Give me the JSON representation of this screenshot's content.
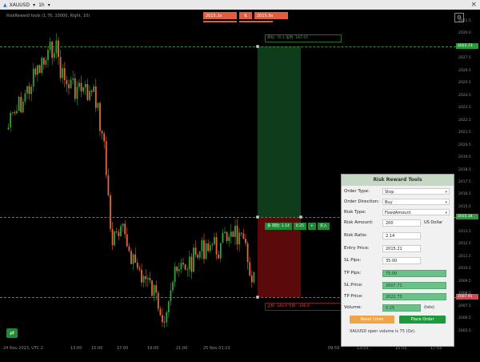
{
  "titlebar": {
    "symbol": "XAUUSD",
    "timeframe": "1h",
    "close_glyph": "×"
  },
  "chart": {
    "indicator_text": "RiskReward tools (1.76, 10000, Right, 10)",
    "bid": "2015.2s",
    "ask": "2015.5s",
    "tp_label": "目标: 70.1 盈利: 187.05",
    "entry_label_parts": [
      "多 风险: 2.14",
      "0.25",
      "+",
      "买入"
    ],
    "sl_label": "止损: 140.9 亏损: -100.0",
    "price_ticks": [
      "2021.5",
      "2020.0",
      "2029.5",
      "2027.5",
      "2026.5",
      "2025.5",
      "2024.5",
      "2023.5",
      "2022.5",
      "2021.5",
      "2020.5",
      "2019.5",
      "2018.5",
      "2017.5",
      "2016.5",
      "2015.5",
      "2014.5",
      "2013.5",
      "2012.5",
      "2011.5",
      "2010.5",
      "2009.5",
      "2008.5",
      "2007.5",
      "2006.5",
      "2005.5"
    ],
    "price_tag_tp": "2022.73",
    "price_tag_entry": "2015.34",
    "price_tag_sl": "2007.91",
    "time_ticks": [
      "24 Nov 2023, UTC 2",
      "13:00",
      "15:00",
      "17:00",
      "19:00",
      "21:00",
      "25 Nov 01:13",
      "09:55",
      "13:55",
      "15:55",
      "17:55"
    ]
  },
  "panel": {
    "title": "Risk Reward Tools",
    "order_type_label": "Order Type:",
    "order_type_value": "Stop",
    "order_direction_label": "Order Direction:",
    "order_direction_value": "Buy",
    "risk_type_label": "Risk Type:",
    "risk_type_value": "FixedAmount",
    "risk_amount_label": "Risk Amount:",
    "risk_amount_value": "200",
    "risk_amount_unit": "US Dollar",
    "risk_ratio_label": "Risk Ratio:",
    "risk_ratio_value": "2.14",
    "entry_price_label": "Entry Price:",
    "entry_price_value": "2015.21",
    "sl_pips_label": "SL Pips:",
    "sl_pips_value": "35.00",
    "tp_pips_label": "TP Pips:",
    "tp_pips_value": "75.00",
    "sl_price_label": "SL Price:",
    "sl_price_value": "2007.71",
    "tp_price_label": "TP Price:",
    "tp_price_value": "2022.73",
    "volume_label": "Volume:",
    "volume_value": "0.25",
    "volume_unit": "(lots)",
    "reset_label": "Reset Lines",
    "place_label": "Place Order",
    "note": "XAUUSD open volume is 75 (Oz)."
  }
}
